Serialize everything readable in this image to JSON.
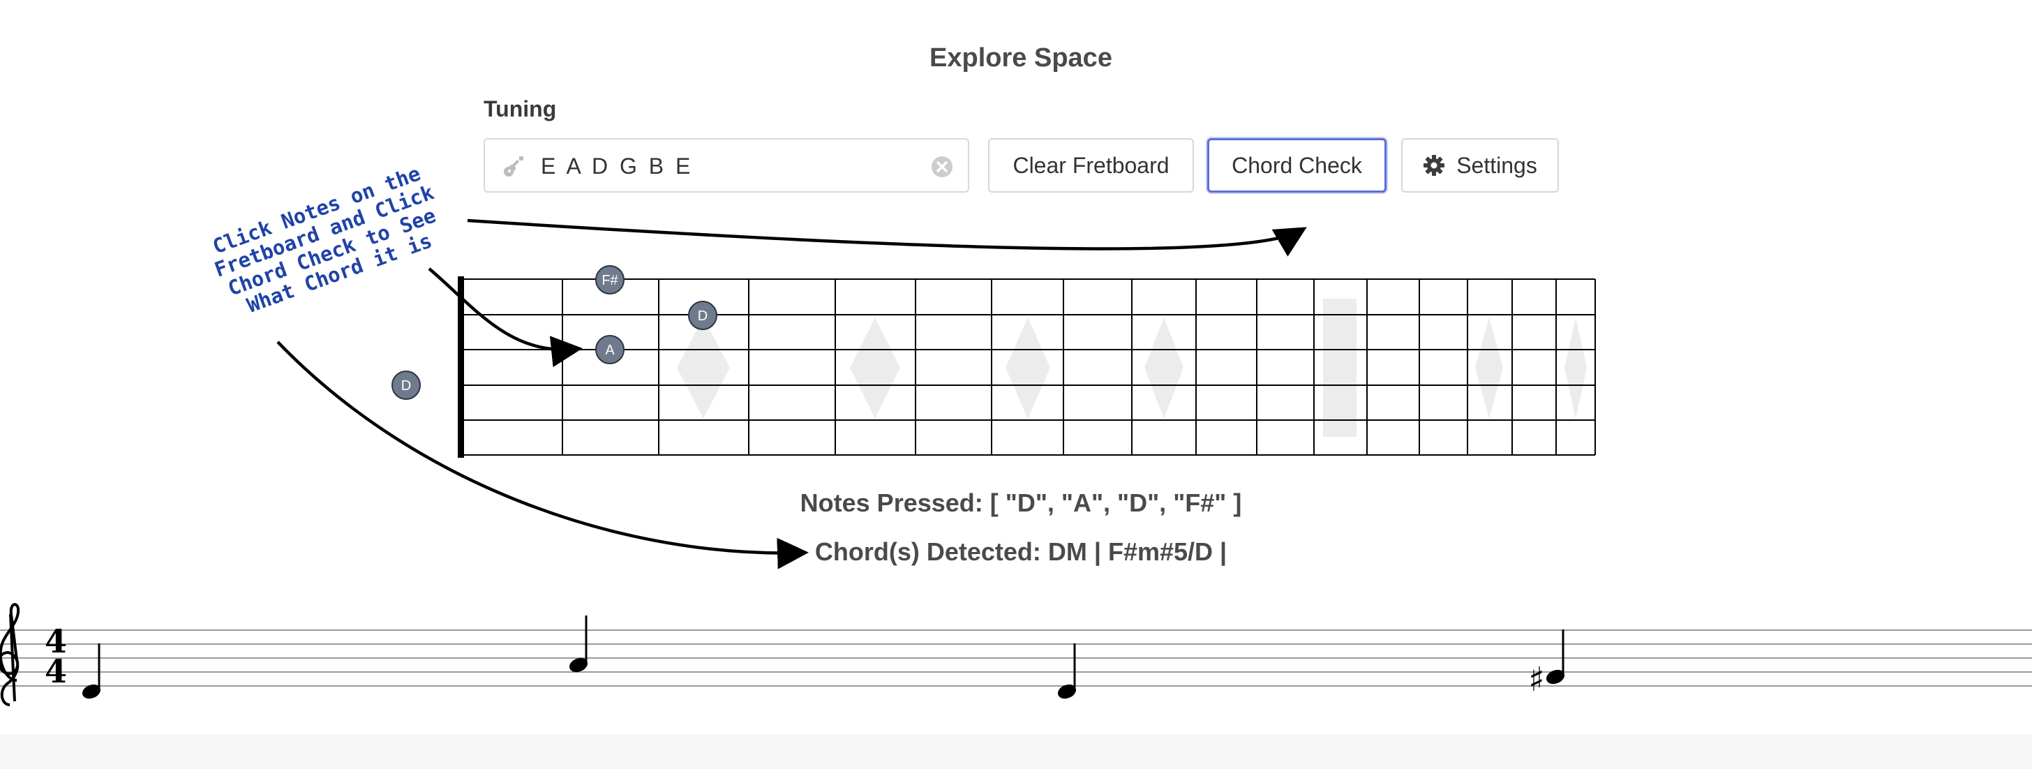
{
  "header": {
    "title": "Explore Space"
  },
  "tuning": {
    "label": "Tuning",
    "value": "E A D G B E",
    "guitar_icon": "guitar-icon",
    "clear_icon": "clear-circle-icon"
  },
  "toolbar": {
    "clear_label": "Clear Fretboard",
    "chord_check_label": "Chord Check",
    "settings_label": "Settings",
    "settings_icon": "gear-icon",
    "accent_color": "#5b6fd6"
  },
  "annotation": {
    "text": "Click Notes on the Fretboard and Click Chord Check to See What Chord it is",
    "color": "#1f43a8"
  },
  "fretboard": {
    "strings": 6,
    "frets": 16,
    "pressed_notes": [
      {
        "note": "F#",
        "string": 1,
        "fret": 2
      },
      {
        "note": "D",
        "string": 2,
        "fret": 3
      },
      {
        "note": "A",
        "string": 3,
        "fret": 2
      },
      {
        "note": "D",
        "string": 4,
        "fret": 0
      }
    ],
    "note_dot_color": "#6f7b8c"
  },
  "results": {
    "notes_pressed_label": "Notes Pressed:",
    "notes_pressed_value": "[ \"D\", \"A\", \"D\", \"F#\" ]",
    "chords_label": "Chord(s) Detected:",
    "chords_value": "DM | F#m#5/D |"
  },
  "staff": {
    "time_signature": {
      "top": "4",
      "bottom": "4"
    },
    "clef": "treble",
    "notes": [
      "D",
      "A",
      "D",
      "F#"
    ]
  }
}
